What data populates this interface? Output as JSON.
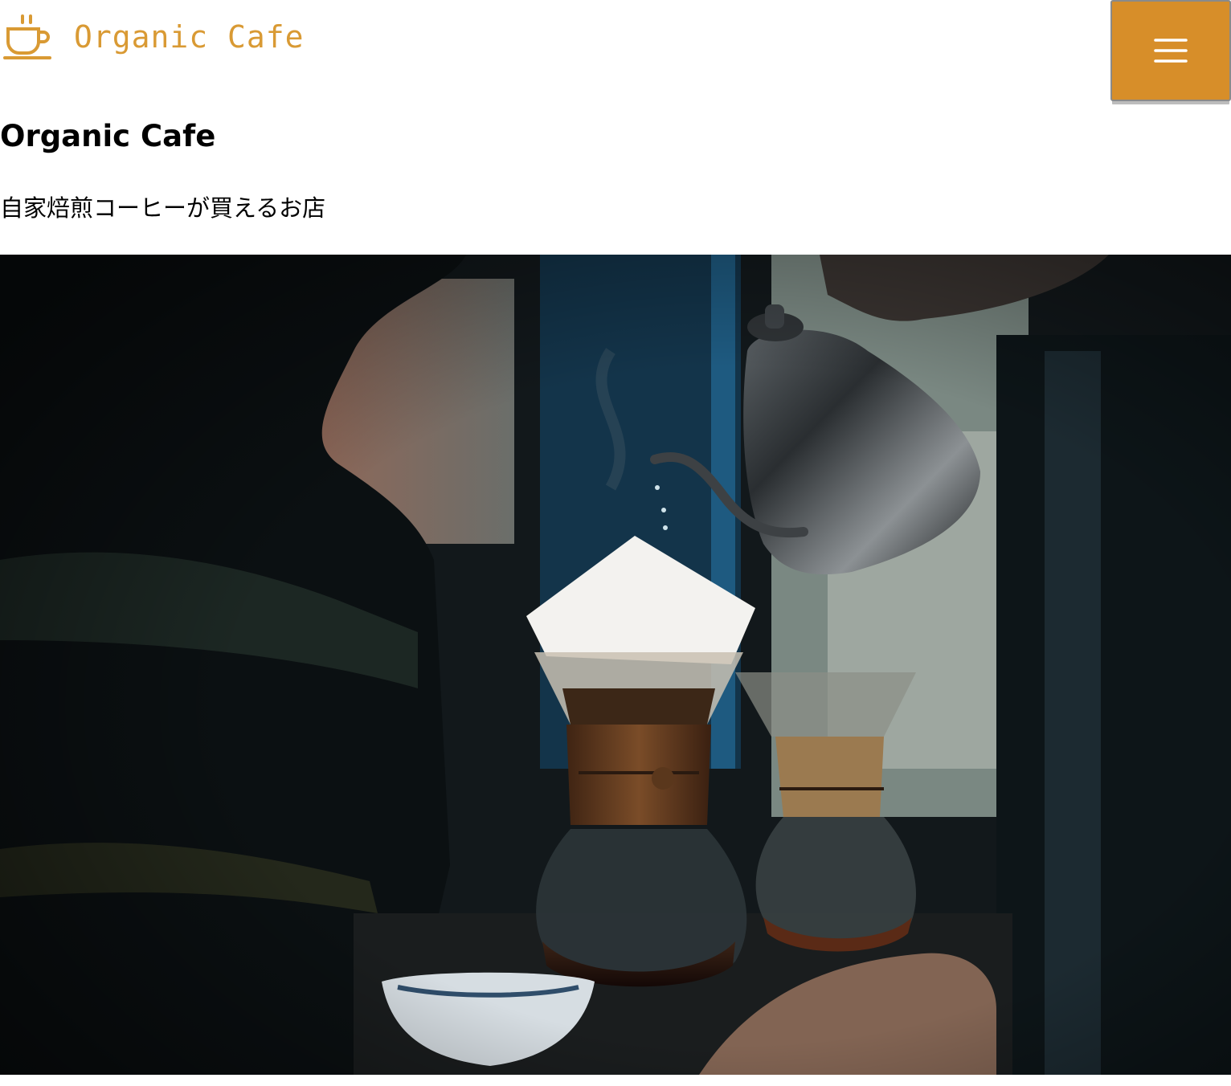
{
  "header": {
    "logo_text": "Organic Cafe",
    "logo_icon": "coffee-cup-icon",
    "menu_icon": "hamburger-menu-icon",
    "menu_aria": "Menu"
  },
  "hero": {
    "title": "Organic Cafe",
    "subtitle": "自家焙煎コーヒーが買えるお店",
    "image_alt": "Barista pouring hot water from a kettle into a pour-over coffee maker"
  },
  "colors": {
    "brand": "#d99a34",
    "menu_button": "#d78e29",
    "text": "#000000",
    "background": "#ffffff"
  }
}
